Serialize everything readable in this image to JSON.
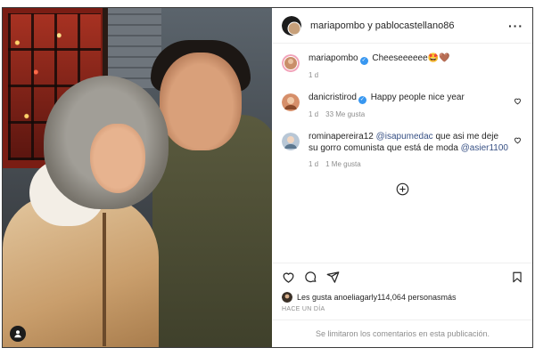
{
  "post": {
    "header": {
      "author": "mariapombo",
      "connector": " y ",
      "coauthor": "pablocastellano86",
      "more_label": "···"
    },
    "caption": {
      "username": "mariapombo",
      "text": "Cheeseeeeee🤩🤎",
      "time": "1 d"
    },
    "comments": [
      {
        "username": "danicristirod",
        "verified": true,
        "text": "Happy people nice year",
        "time": "1 d",
        "likes": "33 Me gusta"
      },
      {
        "username": "rominapereira12",
        "mention1": "@isapumedac",
        "text_middle": " que asi me deje su gorro comunista que está de moda ",
        "mention2": "@asier1100",
        "time": "1 d",
        "likes": "1 Me gusta"
      }
    ],
    "likes": {
      "prefix": "Les gusta a ",
      "user": "noeliagarl",
      "middle": " y ",
      "count": "114,064 personas",
      "suffix": " más"
    },
    "date": "HACE UN DÍA",
    "comments_limited": "Se limitaron los comentarios en esta publicación."
  },
  "colors": {
    "verified": "#3897f0",
    "mention": "#385185",
    "muted": "#8e8e8e"
  },
  "icons": {
    "photo": "person-tag-icon",
    "more": "more-options-icon",
    "comment_like": "heart-outline-icon",
    "load_more": "plus-circle-icon",
    "like": "heart-icon",
    "comment": "comment-icon",
    "share": "share-icon",
    "save": "bookmark-icon"
  }
}
